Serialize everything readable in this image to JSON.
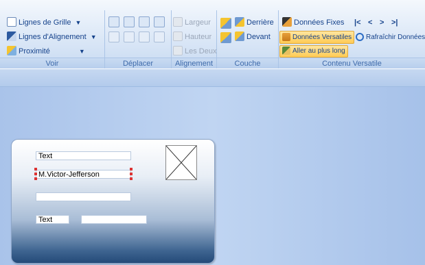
{
  "ribbon": {
    "voir": {
      "label": "Voir",
      "grid_lines": "Lignes de Grille",
      "align_lines": "Lignes d'Alignement",
      "proximity": "Proximité"
    },
    "deplacer": {
      "label": "Déplacer"
    },
    "alignement": {
      "label": "Alignement",
      "width": "Largeur",
      "height": "Hauteur",
      "both": "Les Deux"
    },
    "couche": {
      "label": "Couche",
      "behind": "Derrière",
      "front": "Devant"
    },
    "contenu": {
      "label": "Contenu Versatile",
      "fixed": "Données Fixes",
      "versatile": "Données Versatiles",
      "refresh": "Rafraîchir Données",
      "longest": "Aller au plus long",
      "nav_first": "|<",
      "nav_prev": "<",
      "nav_next": ">",
      "nav_last": ">|"
    }
  },
  "card": {
    "field1": "Text",
    "field2": "M.Victor-Jefferson",
    "field3": "",
    "field4": "Text",
    "field5": ""
  }
}
